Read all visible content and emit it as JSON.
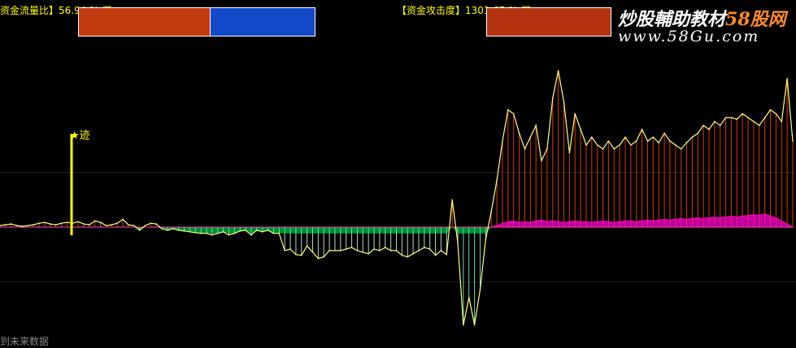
{
  "indicators": {
    "left_text": "资金流量比】56.94 % 买",
    "right_text": "【资金攻击度】1301.65 % 买"
  },
  "watermark": {
    "line1_prefix": "炒股輔助教材",
    "line1_brand": "58股网",
    "line2": "www.58Gu.com"
  },
  "marker": {
    "label": "★迹"
  },
  "footer": {
    "text": "到未来数据"
  },
  "colors": {
    "background": "#000000",
    "main_line": "#ffff80",
    "positive_bars": "#ff4400",
    "negative_bars": "#00ff66",
    "purple_area": "#ff00cc",
    "marker": "#ffff00",
    "swatch_red": "#c23a10",
    "swatch_blue": "#1149c8"
  },
  "chart_data": {
    "type": "area",
    "title": "",
    "xlabel": "",
    "ylabel": "",
    "grid": false,
    "ylim": [
      -140,
      240
    ],
    "series": [
      {
        "values": [
          2,
          3,
          4,
          2,
          1,
          2,
          3,
          5,
          6,
          4,
          3,
          5,
          6,
          5,
          7,
          4,
          3,
          8,
          6,
          2,
          3,
          5,
          10,
          3,
          2,
          -4,
          2,
          5,
          4,
          -2,
          -4,
          -2,
          -4,
          -5,
          -6,
          -7,
          -8,
          -8,
          -10,
          -8,
          -6,
          -10,
          -8,
          -5,
          -4,
          -10,
          -4,
          -6,
          -4,
          -8,
          -8,
          -30,
          -28,
          -35,
          -36,
          -24,
          -32,
          -40,
          -38,
          -30,
          -30,
          -30,
          -28,
          -26,
          -30,
          -32,
          -34,
          -28,
          -30,
          -26,
          -30,
          -30,
          -36,
          -38,
          -34,
          -30,
          -26,
          -28,
          -36,
          -30,
          -35,
          35,
          -20,
          -125,
          -90,
          -125,
          -80,
          -15,
          20,
          60,
          110,
          150,
          145,
          120,
          100,
          115,
          130,
          85,
          100,
          165,
          200,
          160,
          95,
          145,
          125,
          105,
          115,
          105,
          100,
          110,
          100,
          105,
          115,
          105,
          110,
          125,
          110,
          115,
          108,
          120,
          110,
          105,
          100,
          108,
          115,
          120,
          130,
          125,
          135,
          130,
          140,
          140,
          138,
          145,
          140,
          135,
          130,
          140,
          150,
          145,
          135,
          190,
          110
        ]
      },
      {
        "values": [
          0,
          0,
          0,
          0,
          0,
          0,
          0,
          0,
          0,
          0,
          0,
          0,
          0,
          0,
          0,
          0,
          0,
          0,
          0,
          0,
          0,
          0,
          0,
          0,
          0,
          0,
          0,
          0,
          0,
          0,
          0,
          0,
          0,
          0,
          0,
          0,
          0,
          0,
          0,
          0,
          0,
          0,
          0,
          0,
          0,
          0,
          0,
          0,
          0,
          0,
          0,
          0,
          0,
          0,
          0,
          0,
          0,
          0,
          0,
          0,
          0,
          0,
          0,
          0,
          0,
          0,
          0,
          0,
          0,
          0,
          0,
          0,
          0,
          0,
          0,
          0,
          0,
          0,
          0,
          0,
          0,
          0,
          0,
          0,
          0,
          0,
          0,
          0,
          0,
          2,
          5,
          7,
          8,
          6,
          7,
          6,
          8,
          9,
          7,
          8,
          7,
          6,
          7,
          8,
          7,
          7,
          6,
          7,
          8,
          7,
          6,
          7,
          8,
          8,
          7,
          8,
          9,
          8,
          9,
          10,
          9,
          10,
          11,
          10,
          11,
          12,
          11,
          12,
          13,
          12,
          13,
          14,
          13,
          14,
          15,
          16,
          15,
          17,
          14,
          12
        ]
      }
    ]
  }
}
